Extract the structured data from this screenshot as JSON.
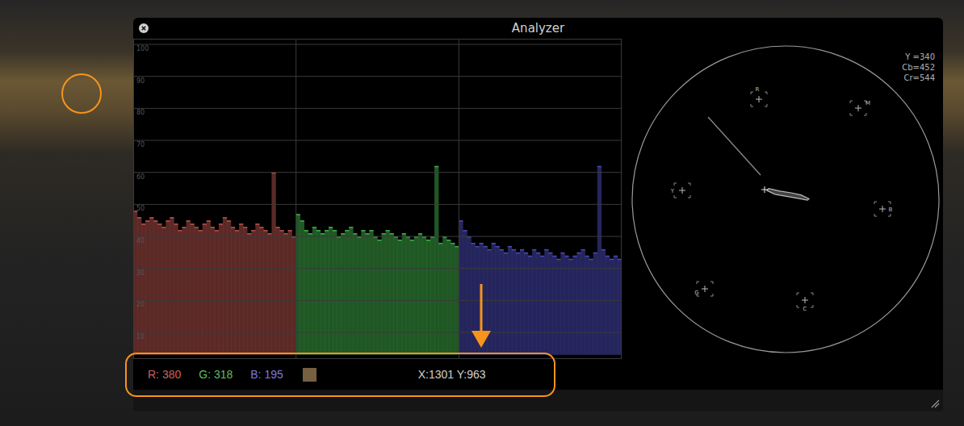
{
  "window": {
    "title": "Analyzer"
  },
  "waveform": {
    "ticks": [
      "100",
      "90",
      "80",
      "70",
      "60",
      "50",
      "40",
      "30",
      "20",
      "10"
    ],
    "series": [
      {
        "name": "R",
        "color": "#b5524c",
        "values": [
          48,
          46,
          44,
          45,
          46,
          45,
          44,
          43,
          45,
          46,
          44,
          42,
          43,
          45,
          44,
          43,
          42,
          44,
          45,
          43,
          42,
          44,
          46,
          45,
          43,
          42,
          44,
          43,
          41,
          42,
          44,
          43,
          42,
          41,
          60,
          43,
          42,
          41,
          42,
          40
        ]
      },
      {
        "name": "G",
        "color": "#3fae49",
        "values": [
          47,
          45,
          42,
          41,
          43,
          42,
          41,
          42,
          43,
          42,
          40,
          41,
          42,
          43,
          41,
          40,
          42,
          41,
          42,
          40,
          39,
          41,
          42,
          41,
          40,
          39,
          41,
          40,
          39,
          40,
          41,
          40,
          39,
          40,
          62,
          38,
          40,
          39,
          38,
          37
        ]
      },
      {
        "name": "B",
        "color": "#4a4ab8",
        "values": [
          45,
          42,
          40,
          38,
          37,
          38,
          37,
          36,
          38,
          37,
          36,
          35,
          37,
          36,
          35,
          36,
          35,
          34,
          36,
          35,
          34,
          36,
          35,
          34,
          33,
          35,
          34,
          33,
          34,
          35,
          36,
          34,
          33,
          35,
          62,
          36,
          34,
          33,
          34,
          33
        ]
      }
    ]
  },
  "vectorscope": {
    "readout": [
      "Y =340",
      "Cb=452",
      "Cr=544"
    ],
    "targets": [
      {
        "label": "R"
      },
      {
        "label": "M"
      },
      {
        "label": "Y"
      },
      {
        "label": "B"
      },
      {
        "label": "G"
      },
      {
        "label": "C"
      }
    ],
    "trace": [
      [
        -38,
        -16
      ],
      [
        -28,
        -19
      ],
      [
        -12,
        -12
      ],
      [
        2,
        -6
      ],
      [
        12,
        -2
      ],
      [
        14,
        4
      ],
      [
        4,
        7
      ],
      [
        -8,
        3
      ],
      [
        -22,
        -4
      ],
      [
        -36,
        -8
      ]
    ]
  },
  "pixel_info": {
    "channels": [
      {
        "label": "R: 380",
        "color": "#c8625c"
      },
      {
        "label": "G: 318",
        "color": "#5fbf5f"
      },
      {
        "label": "B: 195",
        "color": "#7a7ae0"
      }
    ],
    "swatch_color": "#75613f",
    "position": "X:1301 Y:963"
  }
}
